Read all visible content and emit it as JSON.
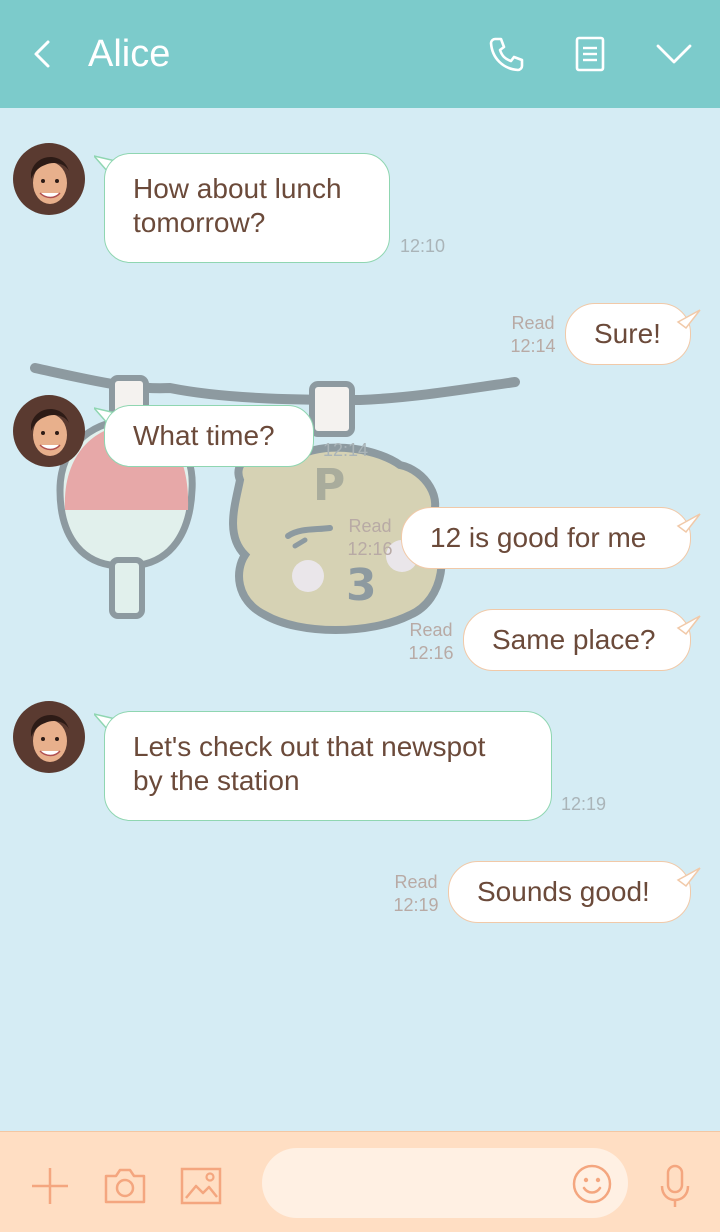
{
  "header": {
    "title": "Alice",
    "icons": [
      "back-icon",
      "phone-icon",
      "notes-icon",
      "chevron-down-icon"
    ],
    "background": "#7ccbcb"
  },
  "messages": [
    {
      "direction": "in",
      "text_line1": "How about lunch",
      "text_line2": "tomorrow?",
      "time": "12:10"
    },
    {
      "direction": "out",
      "text": "Sure!",
      "read": "Read",
      "time": "12:14"
    },
    {
      "direction": "in",
      "text": "What time?",
      "time": "12:14"
    },
    {
      "direction": "out",
      "text": "12 is good for me",
      "read": "Read",
      "time": "12:16"
    },
    {
      "direction": "out",
      "text": "Same place?",
      "read": "Read",
      "time": "12:16"
    },
    {
      "direction": "in",
      "text_line1": "Let's check out that newspot",
      "text_line2": "by the station",
      "time": "12:19"
    },
    {
      "direction": "out",
      "text": "Sounds good!",
      "read": "Read",
      "time": "12:19"
    }
  ],
  "bottom_bar": {
    "icons": [
      "plus-icon",
      "camera-icon",
      "image-icon",
      "emoji-icon",
      "microphone-icon"
    ],
    "input_value": "",
    "input_placeholder": ""
  },
  "colors": {
    "chat_background": "#d5ecf4",
    "incoming_border": "#8fd6b1",
    "outgoing_border": "#f1c9a8",
    "text": "#6b4a3a",
    "bottom_bar": "#ffdec3",
    "icon_accent": "#f4a67f"
  }
}
